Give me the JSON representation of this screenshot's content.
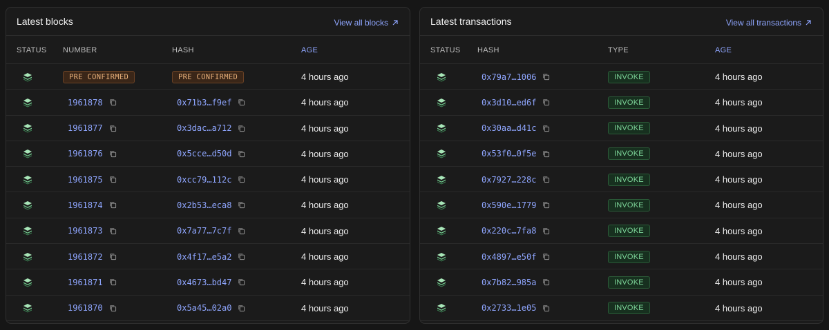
{
  "blocks_panel": {
    "title": "Latest blocks",
    "view_all_label": "View all blocks",
    "columns": {
      "status": "STATUS",
      "number": "NUMBER",
      "hash": "HASH",
      "age": "AGE"
    },
    "rows": [
      {
        "number": "PRE CONFIRMED",
        "hash": "PRE CONFIRMED",
        "age": "4 hours ago",
        "pending": true
      },
      {
        "number": "1961878",
        "hash": "0x71b3…f9ef",
        "age": "4 hours ago"
      },
      {
        "number": "1961877",
        "hash": "0x3dac…a712",
        "age": "4 hours ago"
      },
      {
        "number": "1961876",
        "hash": "0x5cce…d50d",
        "age": "4 hours ago"
      },
      {
        "number": "1961875",
        "hash": "0xcc79…112c",
        "age": "4 hours ago"
      },
      {
        "number": "1961874",
        "hash": "0x2b53…eca8",
        "age": "4 hours ago"
      },
      {
        "number": "1961873",
        "hash": "0x7a77…7c7f",
        "age": "4 hours ago"
      },
      {
        "number": "1961872",
        "hash": "0x4f17…e5a2",
        "age": "4 hours ago"
      },
      {
        "number": "1961871",
        "hash": "0x4673…bd47",
        "age": "4 hours ago"
      },
      {
        "number": "1961870",
        "hash": "0x5a45…02a0",
        "age": "4 hours ago"
      }
    ]
  },
  "tx_panel": {
    "title": "Latest transactions",
    "view_all_label": "View all transactions",
    "columns": {
      "status": "STATUS",
      "hash": "HASH",
      "type": "TYPE",
      "age": "AGE"
    },
    "rows": [
      {
        "hash": "0x79a7…1006",
        "type": "INVOKE",
        "age": "4 hours ago"
      },
      {
        "hash": "0x3d10…ed6f",
        "type": "INVOKE",
        "age": "4 hours ago"
      },
      {
        "hash": "0x30aa…d41c",
        "type": "INVOKE",
        "age": "4 hours ago"
      },
      {
        "hash": "0x53f0…0f5e",
        "type": "INVOKE",
        "age": "4 hours ago"
      },
      {
        "hash": "0x7927…228c",
        "type": "INVOKE",
        "age": "4 hours ago"
      },
      {
        "hash": "0x590e…1779",
        "type": "INVOKE",
        "age": "4 hours ago"
      },
      {
        "hash": "0x220c…7fa8",
        "type": "INVOKE",
        "age": "4 hours ago"
      },
      {
        "hash": "0x4897…e50f",
        "type": "INVOKE",
        "age": "4 hours ago"
      },
      {
        "hash": "0x7b82…985a",
        "type": "INVOKE",
        "age": "4 hours ago"
      },
      {
        "hash": "0x2733…1e05",
        "type": "INVOKE",
        "age": "4 hours ago"
      }
    ]
  },
  "icons": {
    "status": "layers-icon",
    "copy": "copy-icon",
    "external": "arrow-up-right-icon"
  },
  "colors": {
    "accent": "#8fa6ff",
    "status_green": "#7ed69a",
    "pending_orange": "#e8b07a"
  }
}
